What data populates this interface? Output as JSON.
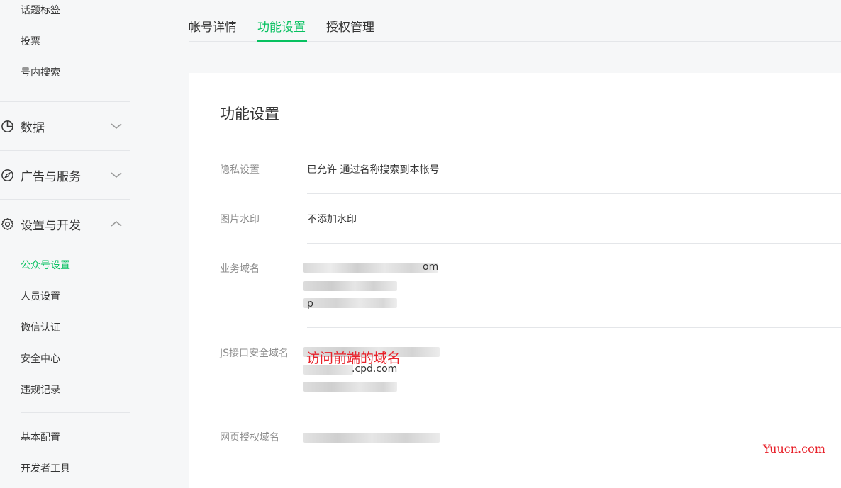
{
  "sidebar": {
    "top_items": [
      "话题标签",
      "投票",
      "号内搜索"
    ],
    "groups": {
      "data": {
        "label": "数据",
        "icon": "pie-chart-icon",
        "expanded": false
      },
      "ads": {
        "label": "广告与服务",
        "icon": "compass-icon",
        "expanded": false
      },
      "settings": {
        "label": "设置与开发",
        "icon": "gear-icon",
        "expanded": true
      }
    },
    "settings_items": [
      "公众号设置",
      "人员设置",
      "微信认证",
      "安全中心",
      "违规记录"
    ],
    "active_item": "公众号设置",
    "dev_items": [
      "基本配置",
      "开发者工具"
    ]
  },
  "tabs": {
    "items": [
      "帐号详情",
      "功能设置",
      "授权管理"
    ],
    "active": "功能设置"
  },
  "content": {
    "title": "功能设置",
    "rows": {
      "privacy": {
        "label": "隐私设置",
        "value": "已允许 通过名称搜索到本帐号"
      },
      "watermark": {
        "label": "图片水印",
        "value": "不添加水印"
      },
      "business_domain": {
        "label": "业务域名",
        "visible_fragments": [
          "om",
          "p"
        ]
      },
      "js_domain": {
        "label": "JS接口安全域名",
        "visible_fragments": [
          ".cpd.com"
        ]
      },
      "oauth_domain": {
        "label": "网页授权域名"
      }
    }
  },
  "annotation": "访问前端的域名",
  "site_watermark": "Yuucn.com",
  "colors": {
    "accent": "#07c160",
    "annotation_red": "#e8212a",
    "page_bg": "#f6f7f8",
    "card_bg": "#ffffff"
  }
}
